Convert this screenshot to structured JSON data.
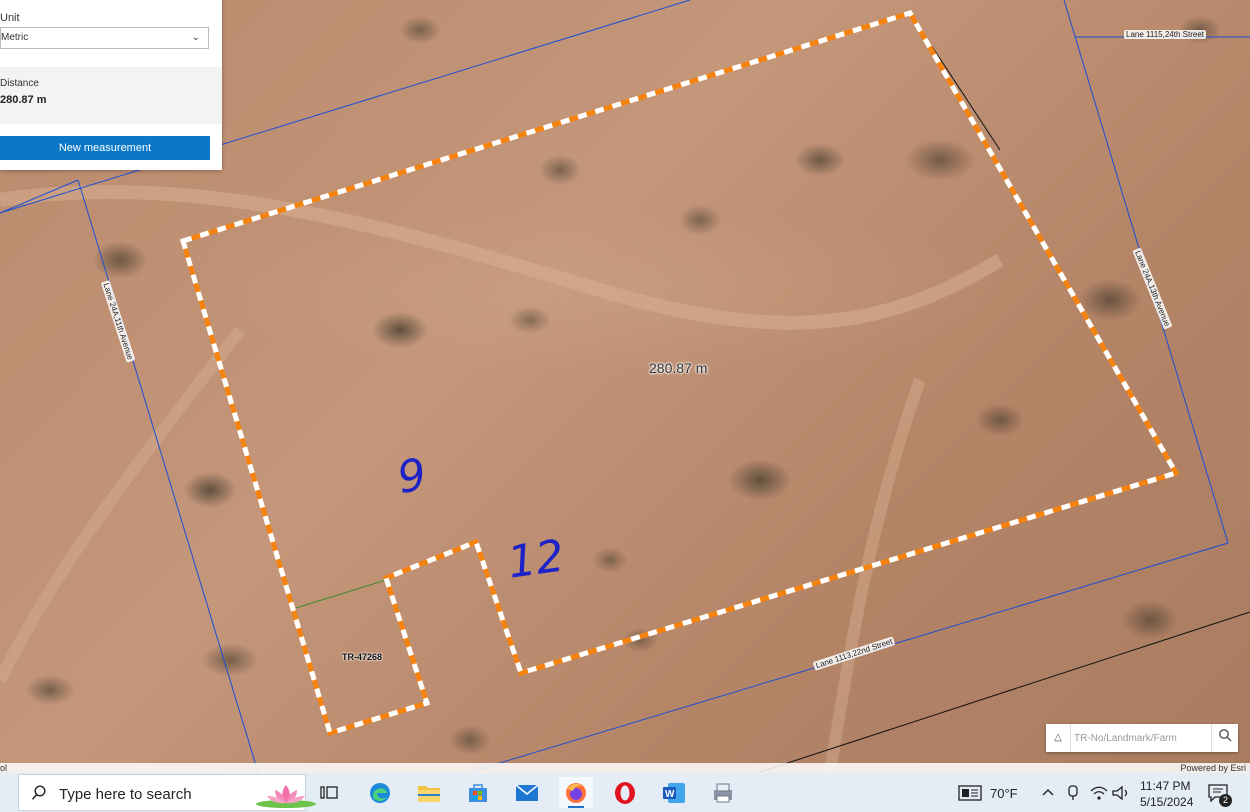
{
  "measure_panel": {
    "unit_label": "Unit",
    "unit_value": "Metric",
    "distance_label": "Distance",
    "distance_value": "280.87 m",
    "new_measurement_label": "New measurement"
  },
  "map": {
    "measurement_label": "280.87 m",
    "parcel_label": "TR-47268",
    "handwritten_notes": [
      "9",
      "12"
    ],
    "road_labels": {
      "top_right": "Lane 1115,24th Street",
      "right": "Lane 24A,13th Avenue",
      "left": "Lane 24A,11th Avenue",
      "bottom": "Lane 1113,22nd Street"
    },
    "colors": {
      "boundary_orange": "#f7830f",
      "boundary_white": "#ffffff",
      "parcel_line": "#1a4fd6"
    }
  },
  "search": {
    "placeholder": "TR-No/Landmark/Farm"
  },
  "attribution": {
    "left": "ol",
    "right": "Powered by Esri"
  },
  "taskbar": {
    "search_text": "Type here to search",
    "weather": "70°F",
    "time": "11:47 PM",
    "date": "5/15/2024",
    "notification_count": "2",
    "apps": [
      "task-view",
      "edge",
      "file-explorer",
      "microsoft-store",
      "mail",
      "firefox",
      "opera",
      "word",
      "other-app"
    ]
  }
}
